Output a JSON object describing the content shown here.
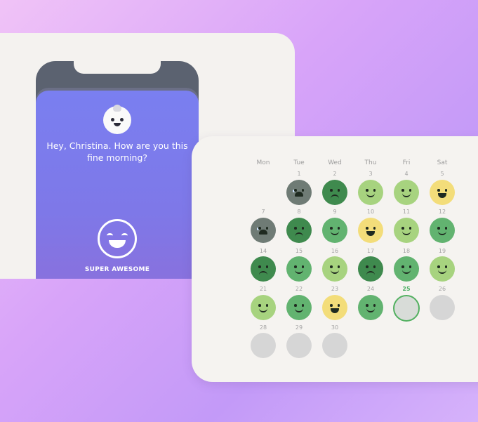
{
  "onboarding": {
    "greeting": "Hey, Christina. How are you this fine morning?",
    "mood_label": "SUPER AWESOME"
  },
  "calendar": {
    "weekdays": [
      "Mon",
      "Tue",
      "Wed",
      "Thu",
      "Fri",
      "Sat"
    ],
    "today": "25",
    "colors": {
      "awful": "#6f7b75",
      "bad": "#3f8a4e",
      "okay": "#62b370",
      "good": "#a7d37f",
      "awesome": "#f3dd7a",
      "empty": "#d6d6d6",
      "today_ring": "#52b060"
    },
    "weeks": [
      [
        {
          "day": "",
          "mood": "none"
        },
        {
          "day": "1",
          "mood": "awful"
        },
        {
          "day": "2",
          "mood": "bad"
        },
        {
          "day": "3",
          "mood": "good"
        },
        {
          "day": "4",
          "mood": "good"
        },
        {
          "day": "5",
          "mood": "awesome"
        }
      ],
      [
        {
          "day": "7",
          "mood": "awful"
        },
        {
          "day": "8",
          "mood": "bad"
        },
        {
          "day": "9",
          "mood": "okay"
        },
        {
          "day": "10",
          "mood": "awesome"
        },
        {
          "day": "11",
          "mood": "good"
        },
        {
          "day": "12",
          "mood": "okay"
        }
      ],
      [
        {
          "day": "14",
          "mood": "bad"
        },
        {
          "day": "15",
          "mood": "okay"
        },
        {
          "day": "16",
          "mood": "good"
        },
        {
          "day": "17",
          "mood": "bad"
        },
        {
          "day": "18",
          "mood": "okay"
        },
        {
          "day": "19",
          "mood": "good"
        }
      ],
      [
        {
          "day": "21",
          "mood": "good"
        },
        {
          "day": "22",
          "mood": "okay"
        },
        {
          "day": "23",
          "mood": "awesome"
        },
        {
          "day": "24",
          "mood": "okay"
        },
        {
          "day": "25",
          "mood": "today"
        },
        {
          "day": "26",
          "mood": "empty"
        }
      ],
      [
        {
          "day": "28",
          "mood": "empty"
        },
        {
          "day": "29",
          "mood": "empty"
        },
        {
          "day": "30",
          "mood": "empty"
        }
      ]
    ]
  }
}
